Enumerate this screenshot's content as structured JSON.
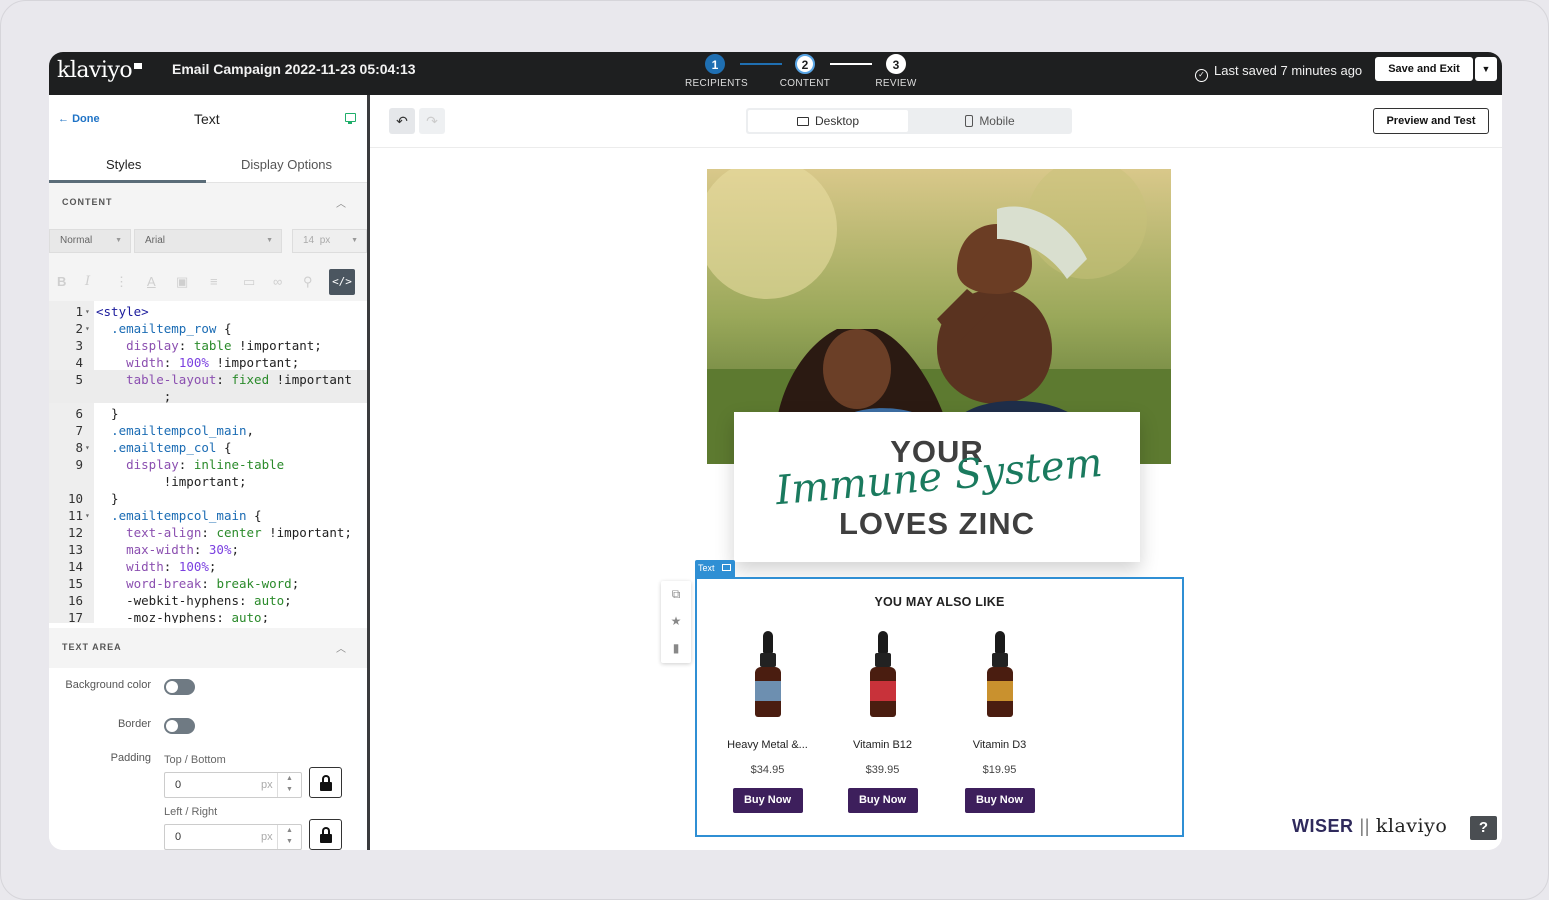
{
  "app": {
    "logo": "klaviyo",
    "campaign_title": "Email Campaign 2022-11-23 05:04:13",
    "steps": [
      {
        "num": "1",
        "label": "RECIPIENTS"
      },
      {
        "num": "2",
        "label": "CONTENT"
      },
      {
        "num": "3",
        "label": "REVIEW"
      }
    ],
    "saved_status": "Last saved 7 minutes ago",
    "save_exit_label": "Save and Exit"
  },
  "left_panel": {
    "done_label": "Done",
    "title": "Text",
    "tabs": [
      "Styles",
      "Display Options"
    ],
    "content_section": "CONTENT",
    "format_select": "Normal",
    "font_select": "Arial",
    "size_value": "14",
    "size_unit": "px",
    "code_lines": [
      {
        "n": "1",
        "fold": true,
        "html": "<span class='tag'>&lt;style&gt;</span>"
      },
      {
        "n": "2",
        "fold": true,
        "html": "  <span class='cls'>.emailtemp_row</span> {"
      },
      {
        "n": "3",
        "fold": false,
        "html": "    <span class='prop'>display</span>: <span class='val'>table</span> !important;"
      },
      {
        "n": "4",
        "fold": false,
        "html": "    <span class='prop'>width</span>: <span class='num'>100%</span> !important;"
      },
      {
        "n": "5",
        "fold": false,
        "html": "    <span class='prop'>table-layout</span>: <span class='val'>fixed</span> !important"
      },
      {
        "n": "",
        "fold": false,
        "html": "         ;"
      },
      {
        "n": "6",
        "fold": false,
        "html": "  }"
      },
      {
        "n": "7",
        "fold": false,
        "html": "  <span class='cls'>.emailtempcol_main</span>,"
      },
      {
        "n": "8",
        "fold": true,
        "html": "  <span class='cls'>.emailtemp_col</span> {"
      },
      {
        "n": "9",
        "fold": false,
        "html": "    <span class='prop'>display</span>: <span class='val'>inline-table</span>"
      },
      {
        "n": "",
        "fold": false,
        "html": "         !important;"
      },
      {
        "n": "10",
        "fold": false,
        "html": "  }"
      },
      {
        "n": "11",
        "fold": true,
        "html": "  <span class='cls'>.emailtempcol_main</span> {"
      },
      {
        "n": "12",
        "fold": false,
        "html": "    <span class='prop'>text-align</span>: <span class='val'>center</span> !important;"
      },
      {
        "n": "13",
        "fold": false,
        "html": "    <span class='prop'>max-width</span>: <span class='num'>30%</span>;"
      },
      {
        "n": "14",
        "fold": false,
        "html": "    <span class='prop'>width</span>: <span class='num'>100%</span>;"
      },
      {
        "n": "15",
        "fold": false,
        "html": "    <span class='prop'>word-break</span>: <span class='val'>break-word</span>;"
      },
      {
        "n": "16",
        "fold": false,
        "html": "    -webkit-hyphens: <span class='val'>auto</span>;"
      },
      {
        "n": "17",
        "fold": false,
        "html": "    -moz-hyphens: <span class='val'>auto</span>;"
      }
    ],
    "text_area_section": "TEXT AREA",
    "background_color_label": "Background color",
    "border_label": "Border",
    "padding_label": "Padding",
    "top_bottom_label": "Top / Bottom",
    "top_bottom_value": "0",
    "left_right_label": "Left / Right",
    "left_right_value": "0",
    "px_unit": "px"
  },
  "canvas": {
    "desktop_label": "Desktop",
    "mobile_label": "Mobile",
    "preview_label": "Preview and Test",
    "headline_top": "YOUR",
    "headline_script": "Immune System",
    "headline_bottom": "LOVES ZINC",
    "block_badge": "Text",
    "section_title": "YOU MAY ALSO LIKE",
    "products": [
      {
        "name": "Heavy Metal &...",
        "price": "$34.95",
        "button": "Buy Now",
        "label_color": "#6d8fb0"
      },
      {
        "name": "Vitamin B12",
        "price": "$39.95",
        "button": "Buy Now",
        "label_color": "#c8323a"
      },
      {
        "name": "Vitamin D3",
        "price": "$19.95",
        "button": "Buy Now",
        "label_color": "#c9912e"
      }
    ],
    "footer_brand": "WISER",
    "footer_sep": "||",
    "footer_klaviyo": "klaviyo",
    "help_label": "?"
  }
}
